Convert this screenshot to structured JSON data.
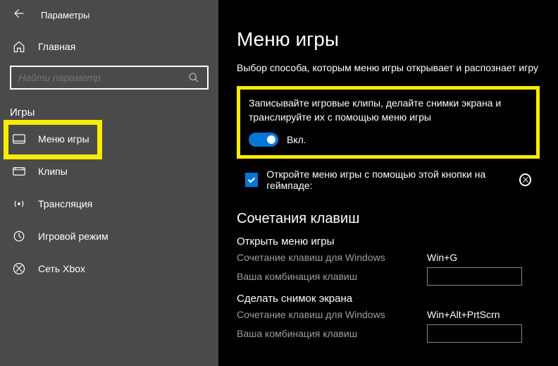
{
  "header": {
    "title": "Параметры"
  },
  "sidebar": {
    "home": "Главная",
    "search_placeholder": "Найти параметр",
    "category": "Игры",
    "items": [
      {
        "label": "Меню игры"
      },
      {
        "label": "Клипы"
      },
      {
        "label": "Трансляция"
      },
      {
        "label": "Игровой режим"
      },
      {
        "label": "Сеть Xbox"
      }
    ]
  },
  "main": {
    "title": "Меню игры",
    "subtitle": "Выбор способа, которым меню игры открывает и распознает игру",
    "record_desc": "Записывайте игровые клипы, делайте снимки экрана и транслируйте их с помощью меню игры",
    "toggle_label": "Вкл.",
    "checkbox_label": "Откройте меню игры с помощью этой кнопки на геймпаде:",
    "shortcuts_heading": "Сочетания клавиш",
    "open_menu": {
      "title": "Открыть меню игры",
      "win_label": "Сочетание клавиш для Windows",
      "win_value": "Win+G",
      "custom_label": "Ваша комбинация клавиш"
    },
    "screenshot": {
      "title": "Сделать снимок экрана",
      "win_label": "Сочетание клавиш для Windows",
      "win_value": "Win+Alt+PrtScrn",
      "custom_label": "Ваша комбинация клавиш"
    }
  }
}
